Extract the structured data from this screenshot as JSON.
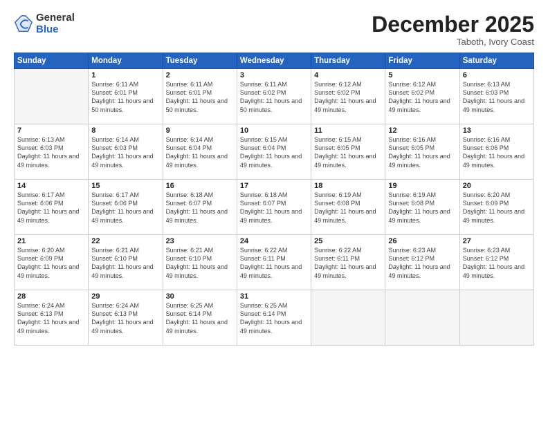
{
  "header": {
    "logo_general": "General",
    "logo_blue": "Blue",
    "month_title": "December 2025",
    "subtitle": "Taboth, Ivory Coast"
  },
  "days_of_week": [
    "Sunday",
    "Monday",
    "Tuesday",
    "Wednesday",
    "Thursday",
    "Friday",
    "Saturday"
  ],
  "weeks": [
    [
      {
        "day": "",
        "sunrise": "",
        "sunset": "",
        "daylight": ""
      },
      {
        "day": "1",
        "sunrise": "Sunrise: 6:11 AM",
        "sunset": "Sunset: 6:01 PM",
        "daylight": "Daylight: 11 hours and 50 minutes."
      },
      {
        "day": "2",
        "sunrise": "Sunrise: 6:11 AM",
        "sunset": "Sunset: 6:01 PM",
        "daylight": "Daylight: 11 hours and 50 minutes."
      },
      {
        "day": "3",
        "sunrise": "Sunrise: 6:11 AM",
        "sunset": "Sunset: 6:02 PM",
        "daylight": "Daylight: 11 hours and 50 minutes."
      },
      {
        "day": "4",
        "sunrise": "Sunrise: 6:12 AM",
        "sunset": "Sunset: 6:02 PM",
        "daylight": "Daylight: 11 hours and 49 minutes."
      },
      {
        "day": "5",
        "sunrise": "Sunrise: 6:12 AM",
        "sunset": "Sunset: 6:02 PM",
        "daylight": "Daylight: 11 hours and 49 minutes."
      },
      {
        "day": "6",
        "sunrise": "Sunrise: 6:13 AM",
        "sunset": "Sunset: 6:03 PM",
        "daylight": "Daylight: 11 hours and 49 minutes."
      }
    ],
    [
      {
        "day": "7",
        "sunrise": "Sunrise: 6:13 AM",
        "sunset": "Sunset: 6:03 PM",
        "daylight": "Daylight: 11 hours and 49 minutes."
      },
      {
        "day": "8",
        "sunrise": "Sunrise: 6:14 AM",
        "sunset": "Sunset: 6:03 PM",
        "daylight": "Daylight: 11 hours and 49 minutes."
      },
      {
        "day": "9",
        "sunrise": "Sunrise: 6:14 AM",
        "sunset": "Sunset: 6:04 PM",
        "daylight": "Daylight: 11 hours and 49 minutes."
      },
      {
        "day": "10",
        "sunrise": "Sunrise: 6:15 AM",
        "sunset": "Sunset: 6:04 PM",
        "daylight": "Daylight: 11 hours and 49 minutes."
      },
      {
        "day": "11",
        "sunrise": "Sunrise: 6:15 AM",
        "sunset": "Sunset: 6:05 PM",
        "daylight": "Daylight: 11 hours and 49 minutes."
      },
      {
        "day": "12",
        "sunrise": "Sunrise: 6:16 AM",
        "sunset": "Sunset: 6:05 PM",
        "daylight": "Daylight: 11 hours and 49 minutes."
      },
      {
        "day": "13",
        "sunrise": "Sunrise: 6:16 AM",
        "sunset": "Sunset: 6:06 PM",
        "daylight": "Daylight: 11 hours and 49 minutes."
      }
    ],
    [
      {
        "day": "14",
        "sunrise": "Sunrise: 6:17 AM",
        "sunset": "Sunset: 6:06 PM",
        "daylight": "Daylight: 11 hours and 49 minutes."
      },
      {
        "day": "15",
        "sunrise": "Sunrise: 6:17 AM",
        "sunset": "Sunset: 6:06 PM",
        "daylight": "Daylight: 11 hours and 49 minutes."
      },
      {
        "day": "16",
        "sunrise": "Sunrise: 6:18 AM",
        "sunset": "Sunset: 6:07 PM",
        "daylight": "Daylight: 11 hours and 49 minutes."
      },
      {
        "day": "17",
        "sunrise": "Sunrise: 6:18 AM",
        "sunset": "Sunset: 6:07 PM",
        "daylight": "Daylight: 11 hours and 49 minutes."
      },
      {
        "day": "18",
        "sunrise": "Sunrise: 6:19 AM",
        "sunset": "Sunset: 6:08 PM",
        "daylight": "Daylight: 11 hours and 49 minutes."
      },
      {
        "day": "19",
        "sunrise": "Sunrise: 6:19 AM",
        "sunset": "Sunset: 6:08 PM",
        "daylight": "Daylight: 11 hours and 49 minutes."
      },
      {
        "day": "20",
        "sunrise": "Sunrise: 6:20 AM",
        "sunset": "Sunset: 6:09 PM",
        "daylight": "Daylight: 11 hours and 49 minutes."
      }
    ],
    [
      {
        "day": "21",
        "sunrise": "Sunrise: 6:20 AM",
        "sunset": "Sunset: 6:09 PM",
        "daylight": "Daylight: 11 hours and 49 minutes."
      },
      {
        "day": "22",
        "sunrise": "Sunrise: 6:21 AM",
        "sunset": "Sunset: 6:10 PM",
        "daylight": "Daylight: 11 hours and 49 minutes."
      },
      {
        "day": "23",
        "sunrise": "Sunrise: 6:21 AM",
        "sunset": "Sunset: 6:10 PM",
        "daylight": "Daylight: 11 hours and 49 minutes."
      },
      {
        "day": "24",
        "sunrise": "Sunrise: 6:22 AM",
        "sunset": "Sunset: 6:11 PM",
        "daylight": "Daylight: 11 hours and 49 minutes."
      },
      {
        "day": "25",
        "sunrise": "Sunrise: 6:22 AM",
        "sunset": "Sunset: 6:11 PM",
        "daylight": "Daylight: 11 hours and 49 minutes."
      },
      {
        "day": "26",
        "sunrise": "Sunrise: 6:23 AM",
        "sunset": "Sunset: 6:12 PM",
        "daylight": "Daylight: 11 hours and 49 minutes."
      },
      {
        "day": "27",
        "sunrise": "Sunrise: 6:23 AM",
        "sunset": "Sunset: 6:12 PM",
        "daylight": "Daylight: 11 hours and 49 minutes."
      }
    ],
    [
      {
        "day": "28",
        "sunrise": "Sunrise: 6:24 AM",
        "sunset": "Sunset: 6:13 PM",
        "daylight": "Daylight: 11 hours and 49 minutes."
      },
      {
        "day": "29",
        "sunrise": "Sunrise: 6:24 AM",
        "sunset": "Sunset: 6:13 PM",
        "daylight": "Daylight: 11 hours and 49 minutes."
      },
      {
        "day": "30",
        "sunrise": "Sunrise: 6:25 AM",
        "sunset": "Sunset: 6:14 PM",
        "daylight": "Daylight: 11 hours and 49 minutes."
      },
      {
        "day": "31",
        "sunrise": "Sunrise: 6:25 AM",
        "sunset": "Sunset: 6:14 PM",
        "daylight": "Daylight: 11 hours and 49 minutes."
      },
      {
        "day": "",
        "sunrise": "",
        "sunset": "",
        "daylight": ""
      },
      {
        "day": "",
        "sunrise": "",
        "sunset": "",
        "daylight": ""
      },
      {
        "day": "",
        "sunrise": "",
        "sunset": "",
        "daylight": ""
      }
    ]
  ]
}
